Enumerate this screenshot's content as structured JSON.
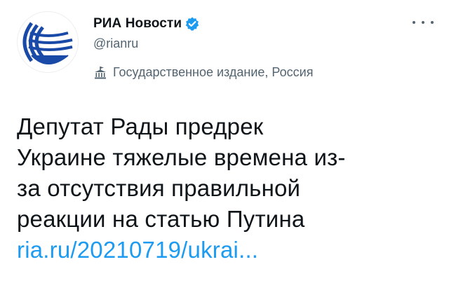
{
  "account": {
    "display_name": "РИА Новости",
    "handle": "@rianru",
    "verified": true,
    "label": "Государственное издание, Россия",
    "avatar_icon": "ria-logo-icon",
    "label_icon": "government-building-icon"
  },
  "tweet": {
    "text_lines": [
      "Депутат Рады предрек",
      "Украине тяжелые времена из-",
      "за отсутствия правильной",
      "реакции на статью Путина"
    ],
    "link": "ria.ru/20210719/ukrai..."
  },
  "icons": {
    "more": "more-horizontal-icon",
    "verified": "verified-badge-icon"
  },
  "colors": {
    "accent": "#1d9bf0",
    "logo_blue": "#1a4aa8",
    "text": "#0f1419",
    "muted": "#536471"
  }
}
